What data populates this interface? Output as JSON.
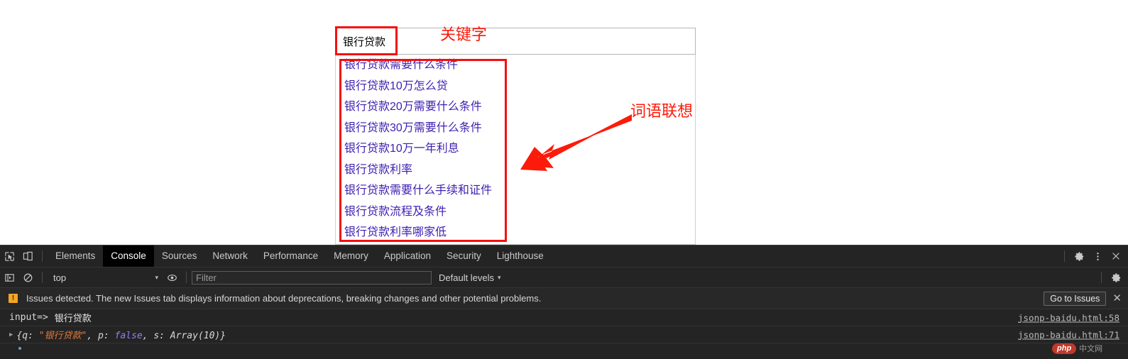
{
  "page": {
    "search": {
      "value": "银行贷款",
      "placeholder": ""
    },
    "suggestions": [
      "银行贷款需要什么条件",
      "银行贷款10万怎么贷",
      "银行贷款20万需要什么条件",
      "银行贷款30万需要什么条件",
      "银行贷款10万一年利息",
      "银行贷款利率",
      "银行贷款需要什么手续和证件",
      "银行贷款流程及条件",
      "银行贷款利率哪家低"
    ],
    "annotations": {
      "keyword_label": "关键字",
      "association_label": "词语联想",
      "color": "#fc1b0b"
    }
  },
  "devtools": {
    "tabs": [
      {
        "label": "Elements",
        "active": false
      },
      {
        "label": "Console",
        "active": true
      },
      {
        "label": "Sources",
        "active": false
      },
      {
        "label": "Network",
        "active": false
      },
      {
        "label": "Performance",
        "active": false
      },
      {
        "label": "Memory",
        "active": false
      },
      {
        "label": "Application",
        "active": false
      },
      {
        "label": "Security",
        "active": false
      },
      {
        "label": "Lighthouse",
        "active": false
      }
    ],
    "icons": {
      "inspect": "inspect-element-icon",
      "device": "device-toolbar-icon",
      "settings": "gear-icon",
      "more": "kebab-menu-icon",
      "close": "✕",
      "sidebar": "console-sidebar-icon",
      "clear": "clear-console-icon",
      "eye": "live-expression-icon"
    },
    "filterbar": {
      "context": "top",
      "filter_placeholder": "Filter",
      "levels": "Default levels",
      "caret": "▾"
    },
    "issues": {
      "badge": "!",
      "message": "Issues detected. The new Issues tab displays information about deprecations, breaking changes and other potential problems.",
      "button": "Go to Issues",
      "close": "✕"
    },
    "console_rows": [
      {
        "type": "log",
        "label": "input=>",
        "text": "银行贷款",
        "source": "jsonp-baidu.html:58"
      },
      {
        "type": "object",
        "arrow": "▶",
        "open": "{q: ",
        "str": "\"银行贷款\"",
        "mid": ", p: ",
        "bool": "false",
        "tail": ", s: Array(10)}",
        "source": "jsonp-baidu.html:71"
      }
    ]
  },
  "watermark": {
    "badge": "php",
    "text": "中文网"
  }
}
